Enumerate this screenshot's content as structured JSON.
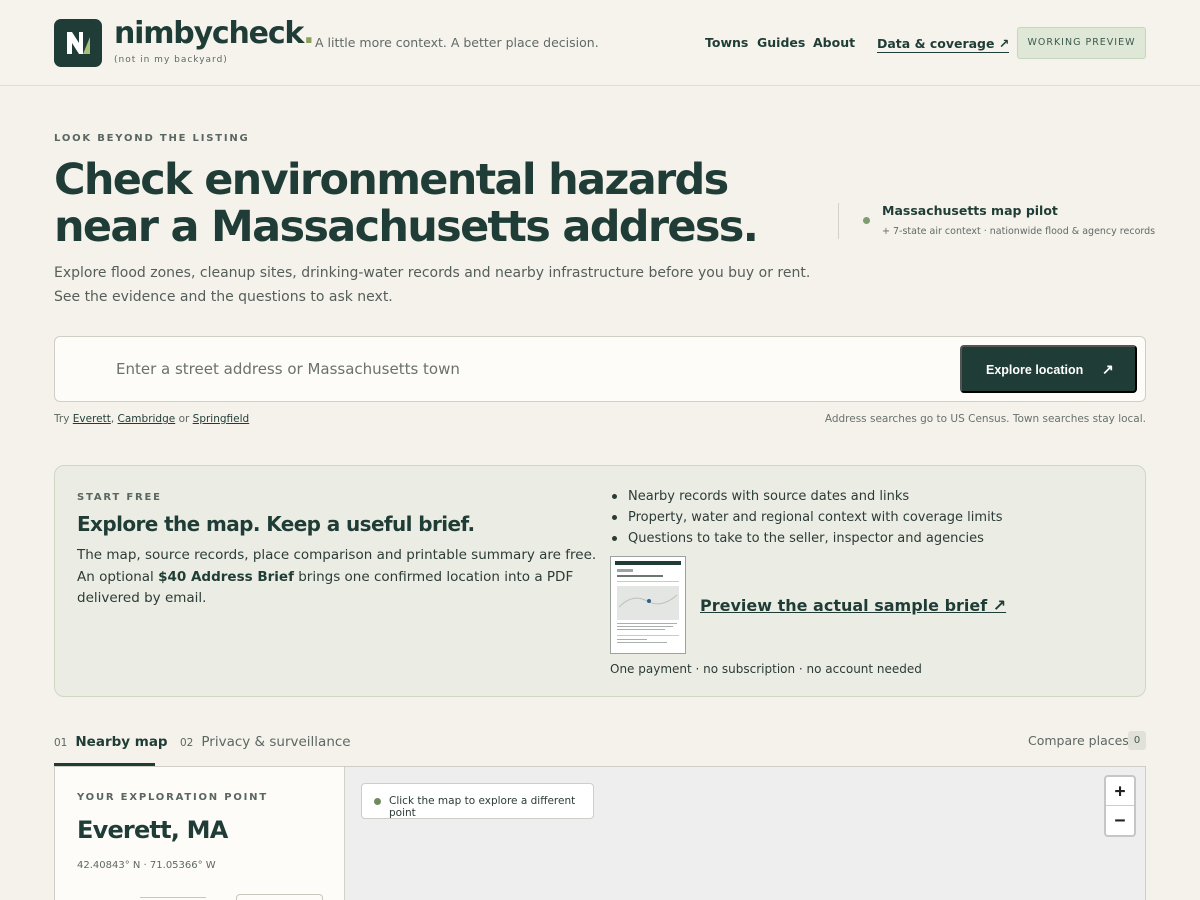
{
  "brand": {
    "name": "nimbycheck",
    "dot": ".",
    "sub": "(not in my backyard)",
    "tagline": "A little more context. A better place decision."
  },
  "nav": {
    "towns": "Towns",
    "guides": "Guides",
    "about": "About",
    "data_coverage": "Data & coverage ↗",
    "badge": "WORKING PREVIEW"
  },
  "hero": {
    "eyebrow": "LOOK BEYOND THE LISTING",
    "title": "Check environmental hazards near a Massachusetts address.",
    "lead": "Explore flood zones, cleanup sites, drinking-water records and nearby infrastructure before you buy or rent. See the evidence and the questions to ask next.",
    "pilot_title": "Massachusetts map pilot",
    "pilot_sub": "+ 7-state air context · nationwide flood & agency records"
  },
  "search": {
    "placeholder": "Enter a street address or Massachusetts town",
    "value": "",
    "button": "Explore location",
    "button_arrow": "↗",
    "try_prefix": "Try",
    "try_1": "Everett",
    "try_sep_1": ",",
    "try_2": "Cambridge",
    "try_sep_2": "or",
    "try_3": "Springfield",
    "note": "Address searches go to US Census. Town searches stay local."
  },
  "start_free": {
    "eyebrow": "START FREE",
    "title": "Explore the map. Keep a useful brief.",
    "text_1": "The map, source records, place comparison and printable summary are free. An optional ",
    "text_bold": "$40 Address Brief",
    "text_2": " brings one confirmed location into a PDF delivered by email.",
    "bullets": [
      "Nearby records with source dates and links",
      "Property, water and regional context with coverage limits",
      "Questions to take to the seller, inspector and agencies"
    ],
    "sample_link": "Preview the actual sample brief ↗",
    "foot": "One payment · no subscription · no account needed"
  },
  "tabs": [
    {
      "num": "01",
      "label": "Nearby map"
    },
    {
      "num": "02",
      "label": "Privacy & surveillance"
    }
  ],
  "compare": {
    "label": "Compare places",
    "count": "0"
  },
  "map": {
    "side_eyebrow": "YOUR EXPLORATION POINT",
    "place": "Everett, MA",
    "coords": "42.40843° N · 71.05366° W",
    "hint": "Click the map to explore a different point",
    "zoom_in": "+",
    "zoom_out": "−"
  },
  "colors": {
    "brand_dark": "#1f3d36",
    "accent_green": "#8aa15c",
    "background": "#f4f2eb",
    "panel": "#ebede4"
  }
}
